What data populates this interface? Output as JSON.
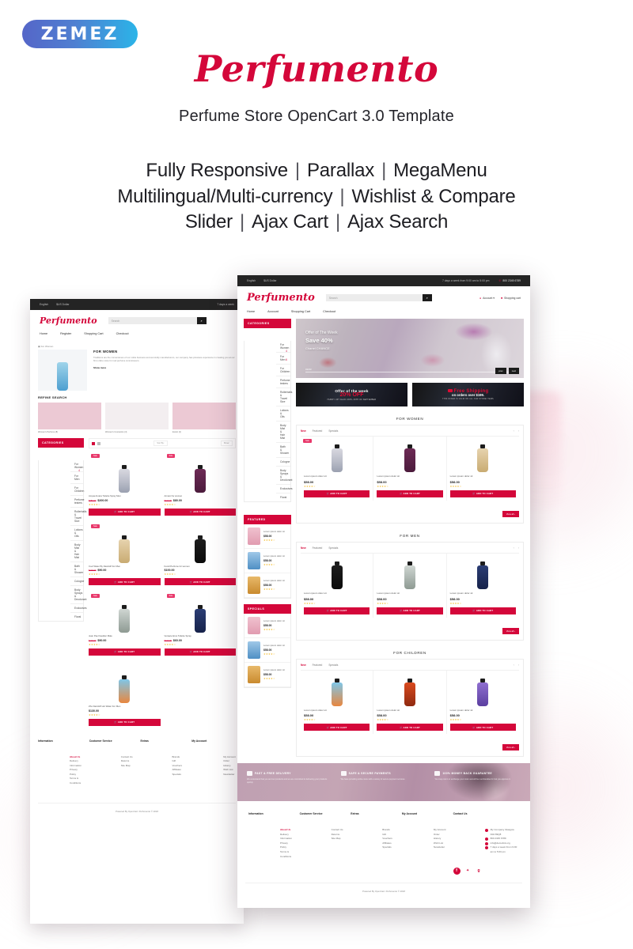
{
  "brand": {
    "vendor_logo": "ZEMEZ",
    "title": "Perfumento",
    "subtitle": "Perfume Store OpenCart 3.0 Template"
  },
  "features": {
    "line1": [
      "Fully Responsive",
      "Parallax",
      "MegaMenu"
    ],
    "line2": [
      "Multilingual/Multi-currency",
      "Wishlist & Compare"
    ],
    "line3": [
      "Slider",
      "Ajax Cart",
      "Ajax Search"
    ],
    "separator": "|"
  },
  "colors": {
    "accent": "#d4073a",
    "dark": "#242424",
    "promo_red": "#e00a33",
    "star": "#f5b923",
    "logo_gradient_start": "#5566c8",
    "logo_gradient_end": "#2bb4e8"
  },
  "front_mockup": {
    "topbar": {
      "language": "English",
      "currency": "$US Dollar",
      "hours": "7 days a week from 9:00 am to 5:00 pm",
      "phone": "800 2345 6789"
    },
    "header": {
      "logo": "Perfumento",
      "search_placeholder": "Search",
      "search_icon": "search-icon",
      "account": "Account",
      "cart": "Shopping cart"
    },
    "nav": [
      "Home",
      "Account",
      "Shopping Cart",
      "Checkout"
    ],
    "categories_title": "CATEGORIES",
    "categories": [
      {
        "label": "For Women",
        "count": "4"
      },
      {
        "label": "For Men",
        "count": "6"
      },
      {
        "label": "For Children",
        "count": ""
      },
      {
        "label": "Perfume testers",
        "count": ""
      },
      {
        "label": "Rollerballs & Travel Size",
        "count": ""
      },
      {
        "label": "Lotions & Oils",
        "count": ""
      },
      {
        "label": "Body Mist & Hair Mist",
        "count": ""
      },
      {
        "label": "Bath & Shower",
        "count": ""
      },
      {
        "label": "Cologne",
        "count": ""
      },
      {
        "label": "Body Sprays & Deodorant",
        "count": ""
      },
      {
        "label": "Exclusives",
        "count": ""
      },
      {
        "label": "Floral",
        "count": ""
      }
    ],
    "featured_title": "FEATURED",
    "featured_items": [
      {
        "name": "Lorem ipsum dolor sit",
        "price": "$58.00"
      },
      {
        "name": "Lorem ipsum dolor sit",
        "price": "$58.00"
      },
      {
        "name": "Lorem ipsum dolor sit",
        "price": "$58.00"
      }
    ],
    "specials_title": "SPECIALS",
    "specials_items": [
      {
        "name": "Lorem ipsum dolor sit",
        "price": "$58.00"
      },
      {
        "name": "Lorem ipsum dolor sit",
        "price": "$58.00"
      },
      {
        "name": "Lorem ipsum dolor sit",
        "price": "$58.00"
      }
    ],
    "hero": {
      "eyebrow": "Offer of The Week",
      "headline": "Save 40%",
      "caption": "Chanel CHANCE",
      "counter": "01/03",
      "prev_label": "prev",
      "next_label": "next"
    },
    "promo_left": {
      "line1": "Offer of the week",
      "line2": "20% OFF",
      "line3": "HURRY UP! VALID UNTIL 30TH OF SEPTEMBER"
    },
    "promo_right": {
      "line1": "Free Shipping",
      "line2": "on orders over $199.",
      "line3": "THIS OFFER IS VALID ON ALL OUR STORE ITEMS"
    },
    "sections": [
      {
        "title": "FOR WOMEN",
        "tabs": [
          "New",
          "Featured",
          "Specials"
        ],
        "products": [
          {
            "name": "Lorem ipsum dolor sit",
            "price": "$58.00",
            "badge": "Sale",
            "button": "ADD TO CART",
            "stars": "★★★★☆"
          },
          {
            "name": "Lorem ipsum dolor sit",
            "price": "$58.00",
            "badge": "",
            "button": "ADD TO CART",
            "stars": "★★★★☆"
          },
          {
            "name": "Lorem ipsum dolor sit",
            "price": "$58.00",
            "badge": "",
            "button": "ADD TO CART",
            "stars": "★★★★☆"
          }
        ],
        "view_all": "View all"
      },
      {
        "title": "FOR MEN",
        "tabs": [
          "New",
          "Featured",
          "Specials"
        ],
        "products": [
          {
            "name": "Lorem ipsum dolor sit",
            "price": "$58.00",
            "badge": "",
            "button": "ADD TO CART",
            "stars": "★★★★☆"
          },
          {
            "name": "Lorem ipsum dolor sit",
            "price": "$58.00",
            "badge": "",
            "button": "ADD TO CART",
            "stars": "★★★★☆"
          },
          {
            "name": "Lorem ipsum dolor sit",
            "price": "$58.00",
            "badge": "",
            "button": "ADD TO CART",
            "stars": "★★★★☆"
          }
        ],
        "view_all": "View all"
      },
      {
        "title": "FOR CHILDREN",
        "tabs": [
          "New",
          "Featured",
          "Specials"
        ],
        "products": [
          {
            "name": "Lorem ipsum dolor sit",
            "price": "$58.00",
            "badge": "",
            "button": "ADD TO CART",
            "stars": "★★★★☆"
          },
          {
            "name": "Lorem ipsum dolor sit",
            "price": "$58.00",
            "badge": "",
            "button": "ADD TO CART",
            "stars": "★★★★☆"
          },
          {
            "name": "Lorem ipsum dolor sit",
            "price": "$58.00",
            "badge": "",
            "button": "ADD TO CART",
            "stars": "★★★★☆"
          }
        ],
        "view_all": "View all"
      }
    ],
    "services": [
      {
        "icon": "truck-icon",
        "title": "FAST & FREE DELIVERY",
        "text": "We understand that you and our products and we are committed to delivering your products quickly."
      },
      {
        "icon": "lock-icon",
        "title": "SAFE & SECURE PAYMENTS",
        "text": "We have providing online store with a variety of secure payment services."
      },
      {
        "icon": "wallet-icon",
        "title": "100% MONEY BACK GUARANTEE",
        "text": "You may return or exchange your order and all the merchandise for risk you approve it."
      }
    ],
    "footer": {
      "columns": [
        {
          "title": "Information",
          "items": [
            "About Us",
            "Delivery Information",
            "Privacy Policy",
            "Terms & Conditions"
          ]
        },
        {
          "title": "Customer Service",
          "items": [
            "Contact Us",
            "Returns",
            "Site Map"
          ]
        },
        {
          "title": "Extras",
          "items": [
            "Brands",
            "Gift Vouchers",
            "Affiliates",
            "Specials"
          ]
        },
        {
          "title": "My Account",
          "items": [
            "My Account",
            "Order History",
            "Wish List",
            "Newsletter"
          ]
        }
      ],
      "contact_title": "Contact Us",
      "contact": [
        "My Company Glasgow D04 89Q8",
        "800 2345 6789",
        "info@demolink.org",
        "7 days a week From 9:00 am to 5:00 pm"
      ],
      "socials": [
        "facebook-icon",
        "twitter-icon",
        "google-plus-icon"
      ],
      "copyright": "Powered By OpenCart. Perfumento © 2018"
    }
  },
  "back_mockup": {
    "topbar": {
      "language": "English",
      "currency": "$US Dollar",
      "hours": "7 days a week"
    },
    "header": {
      "logo": "Perfumento",
      "search_placeholder": "Search"
    },
    "nav": [
      "Home",
      "Register",
      "Shopping Cart",
      "Checkout"
    ],
    "breadcrumb": "For Women",
    "page_title": "FOR WOMEN",
    "page_text": "Traditions are the cornerstones of our noble business and we kindly manufacturers, our company has priceless experience in creating you at our first online store for real perfume connoisseurs.",
    "show_more": "Show more",
    "refine_title": "REFINE SEARCH",
    "refine_items": [
      "Women's Perfume (8)",
      "Women's Cosmetics (4)",
      "Exotic (2)"
    ],
    "categories_title": "CATEGORIES",
    "categories": [
      {
        "label": "For Women",
        "count": "4"
      },
      {
        "label": "For Men",
        "count": ""
      },
      {
        "label": "For Children",
        "count": ""
      },
      {
        "label": "Perfume testers",
        "count": ""
      },
      {
        "label": "Rollerballs & Travel Size",
        "count": ""
      },
      {
        "label": "Lotions & Oils",
        "count": ""
      },
      {
        "label": "Body Mist & Hair Mist",
        "count": ""
      },
      {
        "label": "Bath & Shower",
        "count": ""
      },
      {
        "label": "Cologne",
        "count": ""
      },
      {
        "label": "Body Sprays & Deodorant",
        "count": ""
      },
      {
        "label": "Exclusives",
        "count": ""
      },
      {
        "label": "Floral",
        "count": ""
      }
    ],
    "toolbar": {
      "sort": "Sort By:",
      "show": "Show:"
    },
    "products": [
      {
        "name": "Acqua Amara Toilette Spray Men",
        "price": "$200.00",
        "old_price": "$250.00",
        "badge": "Sale",
        "button": "ADD TO CART",
        "stars": "★★★★☆"
      },
      {
        "name": "Armani for women",
        "price": "$80.00",
        "old_price": "$100.00",
        "badge": "Sale",
        "button": "ADD TO CART",
        "stars": "★★★★☆"
      },
      {
        "name": "Cool Water By Davidoff For Men",
        "price": "$90.00",
        "old_price": "$120.00",
        "badge": "Sale",
        "button": "ADD TO CART",
        "stars": "★★★★☆"
      },
      {
        "name": "Fendi Perfume for women",
        "price": "$100.00",
        "old_price": "",
        "badge": "",
        "button": "ADD TO CART",
        "stars": "★★★★☆"
      },
      {
        "name": "Jean Paul Gaultier Male",
        "price": "$90.00",
        "old_price": "$120.00",
        "badge": "Sale",
        "button": "ADD TO CART",
        "stars": "★★★★☆"
      },
      {
        "name": "Versace Eros Toilette Spray",
        "price": "$60.00",
        "old_price": "$100.00",
        "badge": "Sale",
        "button": "ADD TO CART",
        "stars": "★★★★☆"
      },
      {
        "name": "Zhu Davidoff Hot Water For Men",
        "price": "$130.00",
        "old_price": "",
        "badge": "",
        "button": "ADD TO CART",
        "stars": "★★★★☆"
      }
    ],
    "footer": {
      "columns": [
        {
          "title": "Information",
          "items": [
            "About Us",
            "Delivery Information",
            "Privacy Policy",
            "Terms & Conditions"
          ]
        },
        {
          "title": "Customer Service",
          "items": [
            "Contact Us",
            "Returns",
            "Site Map"
          ]
        },
        {
          "title": "Extras",
          "items": [
            "Brands",
            "Gift Vouchers",
            "Affiliates",
            "Specials"
          ]
        },
        {
          "title": "My Account",
          "items": [
            "My Account",
            "Order History",
            "Wish List",
            "Newsletter"
          ]
        }
      ],
      "copyright": "Powered By OpenCart. Perfumento © 2018"
    }
  }
}
